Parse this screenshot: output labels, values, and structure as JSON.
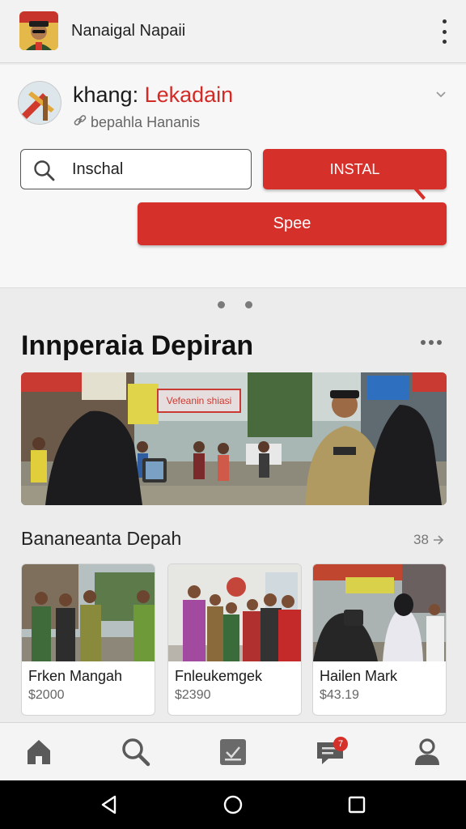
{
  "appbar": {
    "title": "Nanaigal Napaii",
    "logo_icon": "officer-avatar-icon",
    "menu_icon": "kebab-menu-icon"
  },
  "profile": {
    "name_prefix": "khang: ",
    "name_accent": "Lekadain",
    "subtitle": "bepahla Hananis",
    "accent_color": "#d42a26"
  },
  "actions": {
    "search_value": "Inschal",
    "install_label": "INSTAL",
    "spee_label": "Spee"
  },
  "carousel": {
    "pages": 2
  },
  "featured": {
    "title": "Innperaia Depiran",
    "banner_text": "Vefeanin shiasi"
  },
  "listing": {
    "title": "Bananeanta Depah",
    "count": "38",
    "items": [
      {
        "name": "Frken Mangah",
        "price": "$2000"
      },
      {
        "name": "Fnleukemgek",
        "price": "$2390"
      },
      {
        "name": "Hailen Mark",
        "price": "$43.19"
      }
    ]
  },
  "nav": {
    "items": [
      "home-icon",
      "search-icon",
      "calendar-icon",
      "messages-icon",
      "profile-icon"
    ],
    "messages_badge": "7"
  },
  "system": {
    "buttons": [
      "back",
      "home",
      "recents"
    ]
  },
  "colors": {
    "primary_red": "#d6302b",
    "background": "#ececec"
  }
}
